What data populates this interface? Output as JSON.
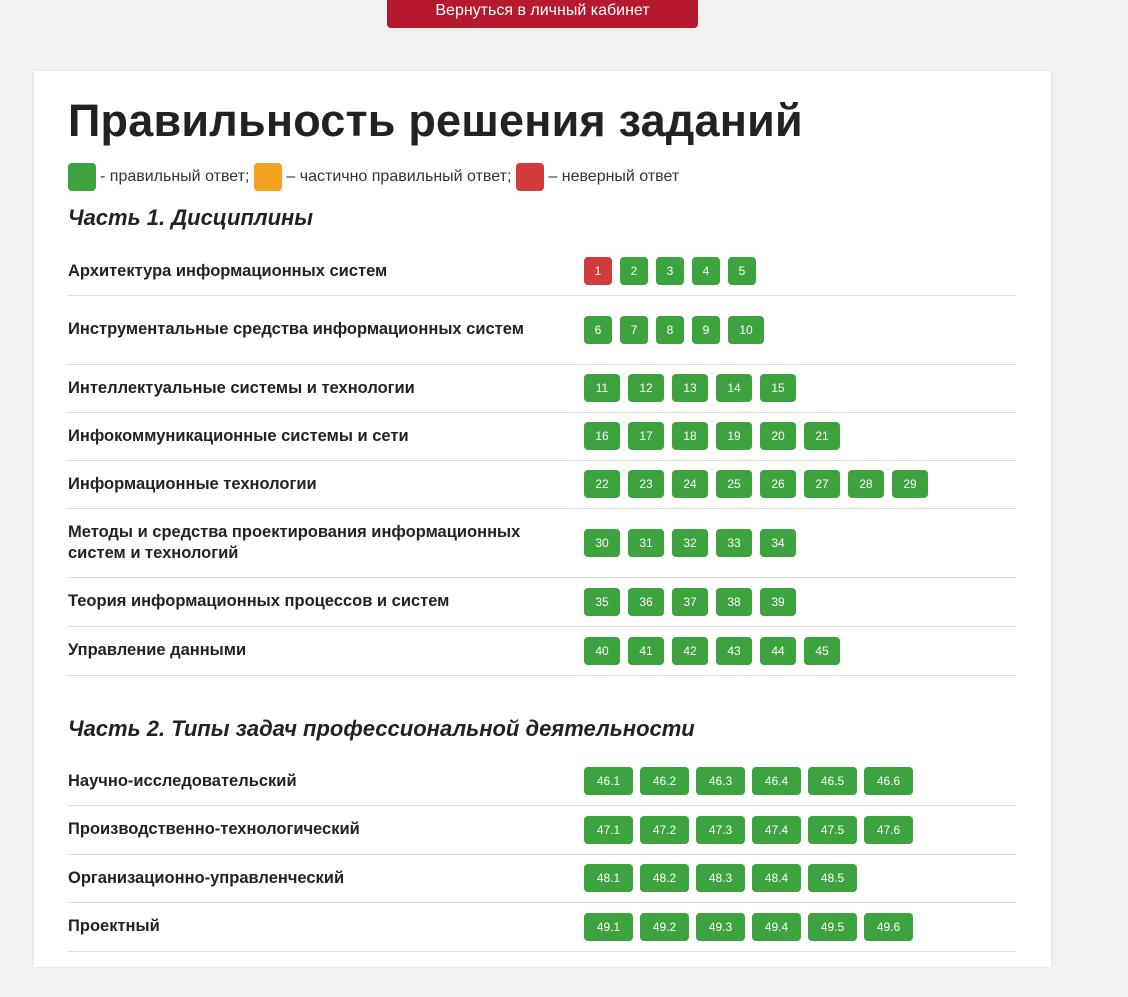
{
  "top_button": {
    "label": "Вернуться в личный кабинет"
  },
  "title": "Правильность решения заданий",
  "colors": {
    "correct": "#3da33f",
    "partial": "#f5a01e",
    "wrong": "#d23b3b"
  },
  "legend": [
    {
      "color": "correct",
      "text": "- правильный ответ;"
    },
    {
      "color": "partial",
      "text": "– частично правильный ответ;"
    },
    {
      "color": "wrong",
      "text": "– неверный ответ"
    }
  ],
  "part1": {
    "title": "Часть 1. Дисциплины",
    "rows": [
      {
        "label": "Архитектура информационных систем",
        "tasks": [
          {
            "n": "1",
            "s": "wrong"
          },
          {
            "n": "2",
            "s": "correct"
          },
          {
            "n": "3",
            "s": "correct"
          },
          {
            "n": "4",
            "s": "correct"
          },
          {
            "n": "5",
            "s": "correct"
          }
        ]
      },
      {
        "label": "Инструментальные средства информационных систем",
        "tasks": [
          {
            "n": "6",
            "s": "correct"
          },
          {
            "n": "7",
            "s": "correct"
          },
          {
            "n": "8",
            "s": "correct"
          },
          {
            "n": "9",
            "s": "correct"
          },
          {
            "n": "10",
            "s": "correct"
          }
        ]
      },
      {
        "label": "Интеллектуальные системы и технологии",
        "tasks": [
          {
            "n": "11",
            "s": "correct"
          },
          {
            "n": "12",
            "s": "correct"
          },
          {
            "n": "13",
            "s": "correct"
          },
          {
            "n": "14",
            "s": "correct"
          },
          {
            "n": "15",
            "s": "correct"
          }
        ]
      },
      {
        "label": "Инфокоммуникационные системы и сети",
        "tasks": [
          {
            "n": "16",
            "s": "correct"
          },
          {
            "n": "17",
            "s": "correct"
          },
          {
            "n": "18",
            "s": "correct"
          },
          {
            "n": "19",
            "s": "correct"
          },
          {
            "n": "20",
            "s": "correct"
          },
          {
            "n": "21",
            "s": "correct"
          }
        ]
      },
      {
        "label": "Информационные технологии",
        "tasks": [
          {
            "n": "22",
            "s": "correct"
          },
          {
            "n": "23",
            "s": "correct"
          },
          {
            "n": "24",
            "s": "correct"
          },
          {
            "n": "25",
            "s": "correct"
          },
          {
            "n": "26",
            "s": "correct"
          },
          {
            "n": "27",
            "s": "correct"
          },
          {
            "n": "28",
            "s": "correct"
          },
          {
            "n": "29",
            "s": "correct"
          }
        ]
      },
      {
        "label": "Методы и средства проектирования информационных систем и технологий",
        "tasks": [
          {
            "n": "30",
            "s": "correct"
          },
          {
            "n": "31",
            "s": "correct"
          },
          {
            "n": "32",
            "s": "correct"
          },
          {
            "n": "33",
            "s": "correct"
          },
          {
            "n": "34",
            "s": "correct"
          }
        ]
      },
      {
        "label": "Теория информационных процессов и систем",
        "tasks": [
          {
            "n": "35",
            "s": "correct"
          },
          {
            "n": "36",
            "s": "correct"
          },
          {
            "n": "37",
            "s": "correct"
          },
          {
            "n": "38",
            "s": "correct"
          },
          {
            "n": "39",
            "s": "correct"
          }
        ]
      },
      {
        "label": "Управление данными",
        "tasks": [
          {
            "n": "40",
            "s": "correct"
          },
          {
            "n": "41",
            "s": "correct"
          },
          {
            "n": "42",
            "s": "correct"
          },
          {
            "n": "43",
            "s": "correct"
          },
          {
            "n": "44",
            "s": "correct"
          },
          {
            "n": "45",
            "s": "correct"
          }
        ]
      }
    ]
  },
  "part2": {
    "title": "Часть 2. Типы задач профессиональной деятельности",
    "rows": [
      {
        "label": "Научно-исследовательский",
        "tasks": [
          {
            "n": "46.1",
            "s": "correct"
          },
          {
            "n": "46.2",
            "s": "correct"
          },
          {
            "n": "46.3",
            "s": "correct"
          },
          {
            "n": "46.4",
            "s": "correct"
          },
          {
            "n": "46.5",
            "s": "correct"
          },
          {
            "n": "46.6",
            "s": "correct"
          }
        ]
      },
      {
        "label": "Производственно-технологический",
        "tasks": [
          {
            "n": "47.1",
            "s": "correct"
          },
          {
            "n": "47.2",
            "s": "correct"
          },
          {
            "n": "47.3",
            "s": "correct"
          },
          {
            "n": "47.4",
            "s": "correct"
          },
          {
            "n": "47.5",
            "s": "correct"
          },
          {
            "n": "47.6",
            "s": "correct"
          }
        ]
      },
      {
        "label": "Организационно-управленческий",
        "tasks": [
          {
            "n": "48.1",
            "s": "correct"
          },
          {
            "n": "48.2",
            "s": "correct"
          },
          {
            "n": "48.3",
            "s": "correct"
          },
          {
            "n": "48.4",
            "s": "correct"
          },
          {
            "n": "48.5",
            "s": "correct"
          }
        ]
      },
      {
        "label": "Проектный",
        "tasks": [
          {
            "n": "49.1",
            "s": "correct"
          },
          {
            "n": "49.2",
            "s": "correct"
          },
          {
            "n": "49.3",
            "s": "correct"
          },
          {
            "n": "49.4",
            "s": "correct"
          },
          {
            "n": "49.5",
            "s": "correct"
          },
          {
            "n": "49.6",
            "s": "correct"
          }
        ]
      }
    ]
  }
}
